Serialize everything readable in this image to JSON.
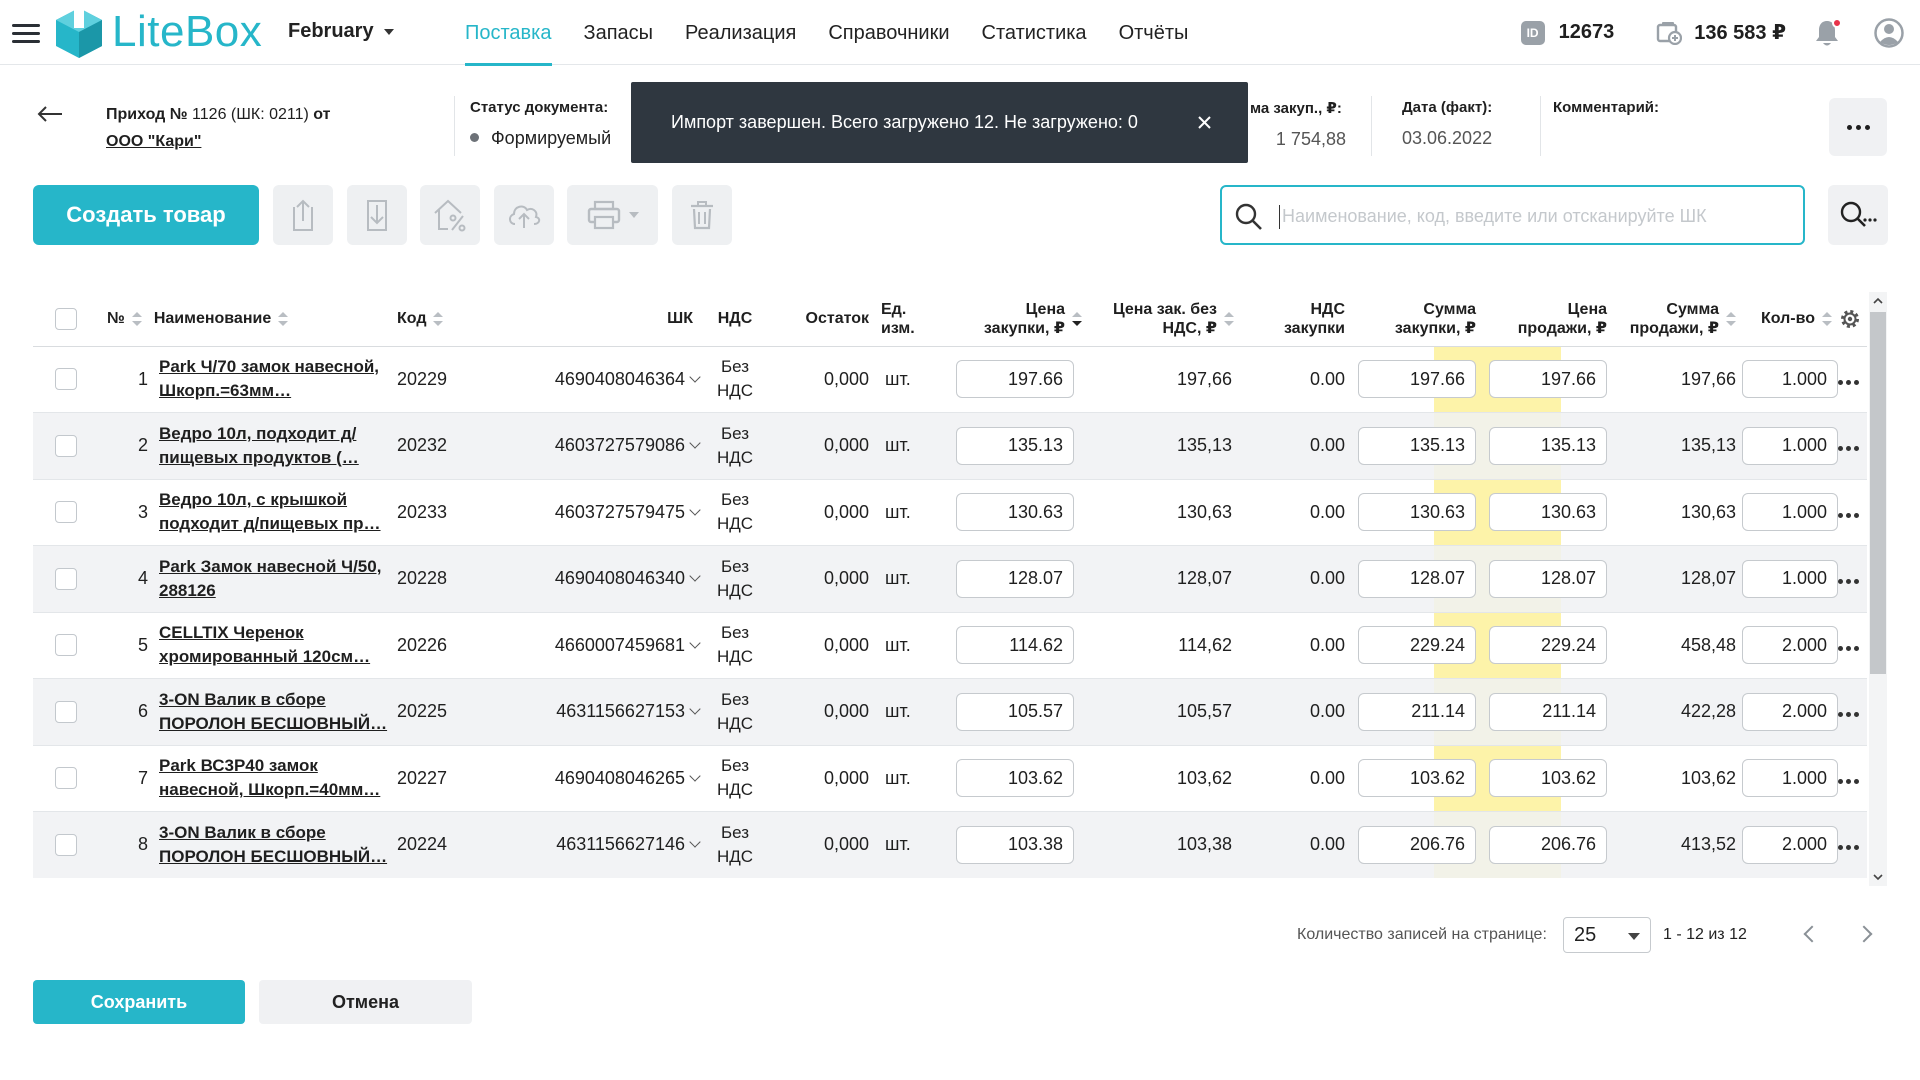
{
  "header": {
    "logo_text": "LiteBox",
    "month": "February",
    "nav": [
      {
        "label": "Поставка",
        "active": true
      },
      {
        "label": "Запасы"
      },
      {
        "label": "Реализация"
      },
      {
        "label": "Справочники"
      },
      {
        "label": "Статистика"
      },
      {
        "label": "Отчёты"
      }
    ],
    "id_value": "12673",
    "id_icon_text": "ID",
    "balance": "136 583 ₽",
    "accent": "#26b6c9"
  },
  "document": {
    "title_prefix": "Приход №",
    "title_number": " 1126 (ШК: 0211) ",
    "title_suffix": "от",
    "supplier": "ООО \"Кари\"",
    "status_label": "Статус документа:",
    "status_value": "Формируемый",
    "sum_label": "ма закуп., ₽:",
    "sum_value": "1 754,88",
    "date_label": "Дата (факт):",
    "date_value": "03.06.2022",
    "comment_label": "Комментарий:",
    "comment_value": ""
  },
  "toast": {
    "message": "Импорт завершен. Всего загружено 12. Не загружено: 0"
  },
  "toolbar": {
    "create_label": "Создать товар",
    "search_placeholder": "Наименование, код, введите или отсканируйте ШК",
    "search_value": ""
  },
  "table": {
    "columns": {
      "num": "№",
      "name": "Наименование",
      "code": "Код",
      "barcode": "ШК",
      "vat": "НДС",
      "stock": "Остаток",
      "unit_1": "Ед.",
      "unit_2": "изм.",
      "price_1": "Цена",
      "price_2": "закупки, ₽",
      "price_novat_1": "Цена зак. без",
      "price_novat_2": "НДС, ₽",
      "vat_buy_1": "НДС",
      "vat_buy_2": "закупки",
      "sum_buy_1": "Сумма",
      "sum_buy_2": "закупки, ₽",
      "sale_price_1": "Цена",
      "sale_price_2": "продажи, ₽",
      "sum_sale_1": "Сумма",
      "sum_sale_2": "продажи, ₽",
      "qty": "Кол-во"
    },
    "rows": [
      {
        "num": "1",
        "name": "Park Ч/70 замок навесной, Шкорп.=63мм…",
        "code": "20229",
        "barcode": "4690408046364",
        "vat_1": "Без",
        "vat_2": "НДС",
        "stock": "0,000",
        "unit": "шт.",
        "price": "197.66",
        "price_novat": "197,66",
        "vat_buy": "0.00",
        "sum_buy": "197.66",
        "sale_price": "197.66",
        "sum_sale": "197,66",
        "qty": "1.000"
      },
      {
        "num": "2",
        "name": "Ведро 10л, подходит д/пищевых продуктов (…",
        "code": "20232",
        "barcode": "4603727579086",
        "vat_1": "Без",
        "vat_2": "НДС",
        "stock": "0,000",
        "unit": "шт.",
        "price": "135.13",
        "price_novat": "135,13",
        "vat_buy": "0.00",
        "sum_buy": "135.13",
        "sale_price": "135.13",
        "sum_sale": "135,13",
        "qty": "1.000"
      },
      {
        "num": "3",
        "name": "Ведро 10л, с крышкой подходит д/пищевых пр…",
        "code": "20233",
        "barcode": "4603727579475",
        "vat_1": "Без",
        "vat_2": "НДС",
        "stock": "0,000",
        "unit": "шт.",
        "price": "130.63",
        "price_novat": "130,63",
        "vat_buy": "0.00",
        "sum_buy": "130.63",
        "sale_price": "130.63",
        "sum_sale": "130,63",
        "qty": "1.000"
      },
      {
        "num": "4",
        "name": "Park Замок навесной Ч/50, 288126",
        "code": "20228",
        "barcode": "4690408046340",
        "vat_1": "Без",
        "vat_2": "НДС",
        "stock": "0,000",
        "unit": "шт.",
        "price": "128.07",
        "price_novat": "128,07",
        "vat_buy": "0.00",
        "sum_buy": "128.07",
        "sale_price": "128.07",
        "sum_sale": "128,07",
        "qty": "1.000"
      },
      {
        "num": "5",
        "name": "CELLTIX Черенок хромированный 120см…",
        "code": "20226",
        "barcode": "4660007459681",
        "vat_1": "Без",
        "vat_2": "НДС",
        "stock": "0,000",
        "unit": "шт.",
        "price": "114.62",
        "price_novat": "114,62",
        "vat_buy": "0.00",
        "sum_buy": "229.24",
        "sale_price": "229.24",
        "sum_sale": "458,48",
        "qty": "2.000"
      },
      {
        "num": "6",
        "name": "3-ON Валик в сборе ПОРОЛОН БЕСШОВНЫЙ…",
        "code": "20225",
        "barcode": "4631156627153",
        "vat_1": "Без",
        "vat_2": "НДС",
        "stock": "0,000",
        "unit": "шт.",
        "price": "105.57",
        "price_novat": "105,57",
        "vat_buy": "0.00",
        "sum_buy": "211.14",
        "sale_price": "211.14",
        "sum_sale": "422,28",
        "qty": "2.000"
      },
      {
        "num": "7",
        "name": "Park ВС3Р40 замок навесной, Шкорп.=40мм…",
        "code": "20227",
        "barcode": "4690408046265",
        "vat_1": "Без",
        "vat_2": "НДС",
        "stock": "0,000",
        "unit": "шт.",
        "price": "103.62",
        "price_novat": "103,62",
        "vat_buy": "0.00",
        "sum_buy": "103.62",
        "sale_price": "103.62",
        "sum_sale": "103,62",
        "qty": "1.000"
      },
      {
        "num": "8",
        "name": "3-ON Валик в сборе ПОРОЛОН БЕСШОВНЫЙ…",
        "code": "20224",
        "barcode": "4631156627146",
        "vat_1": "Без",
        "vat_2": "НДС",
        "stock": "0,000",
        "unit": "шт.",
        "price": "103.38",
        "price_novat": "103,38",
        "vat_buy": "0.00",
        "sum_buy": "206.76",
        "sale_price": "206.76",
        "sum_sale": "413,52",
        "qty": "2.000"
      }
    ]
  },
  "pagination": {
    "per_page_label": "Количество записей на странице:",
    "per_page": "25",
    "range": "1 - 12 из 12"
  },
  "footer": {
    "save_label": "Сохранить",
    "cancel_label": "Отмена"
  }
}
